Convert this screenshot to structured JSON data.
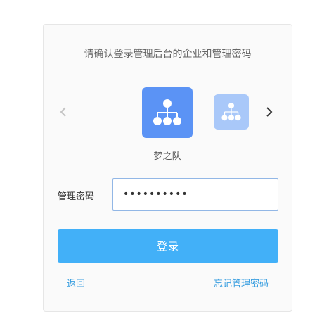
{
  "card": {
    "title": "请确认登录管理后台的企业和管理密码"
  },
  "carousel": {
    "prev_icon": "chevron-left-icon",
    "next_icon": "chevron-right-icon",
    "current_org_icon": "org-chart-icon",
    "next_org_icon": "org-chart-icon",
    "current_org_name": "梦之队"
  },
  "form": {
    "password_label": "管理密码",
    "password_value": "••••••••••"
  },
  "actions": {
    "login_label": "登录",
    "back_label": "返回",
    "forgot_label": "忘记管理密码"
  },
  "colors": {
    "accent": "#42b0f8",
    "org_active": "#5b93f5",
    "org_inactive": "#a9c8f9",
    "link": "#3a9fe0"
  }
}
